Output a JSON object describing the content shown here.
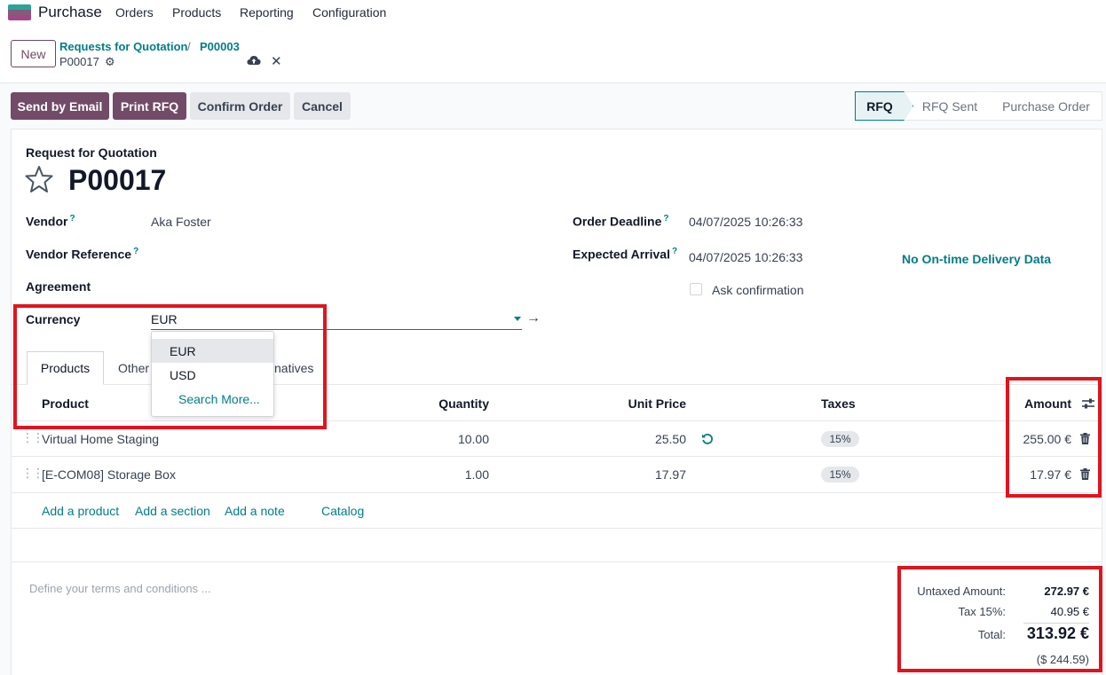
{
  "nav": {
    "app_name": "Purchase",
    "menu": [
      "Orders",
      "Products",
      "Reporting",
      "Configuration"
    ]
  },
  "control": {
    "new_label": "New",
    "breadcrumb": [
      "Requests for Quotation",
      "P00003"
    ],
    "breadcrumb_sep": "/",
    "record": "P00017"
  },
  "actions": {
    "send_email": "Send by Email",
    "print_rfq": "Print RFQ",
    "confirm": "Confirm Order",
    "cancel": "Cancel"
  },
  "statusbar": [
    "RFQ",
    "RFQ Sent",
    "Purchase Order"
  ],
  "form": {
    "doc_type": "Request for Quotation",
    "doc_name": "P00017",
    "vendor_label": "Vendor",
    "vendor_value": "Aka Foster",
    "vendor_ref_label": "Vendor Reference",
    "agreement_label": "Agreement",
    "currency_label": "Currency",
    "currency_value": "EUR",
    "order_deadline_label": "Order Deadline",
    "order_deadline_value": "04/07/2025 10:26:33",
    "expected_arrival_label": "Expected Arrival",
    "expected_arrival_value": "04/07/2025 10:26:33",
    "ask_confirmation_label": "Ask confirmation",
    "delivery_data": "No On-time Delivery Data",
    "help_mark": "?"
  },
  "currency_dropdown": [
    "EUR",
    "USD",
    "Search More..."
  ],
  "tabs": {
    "products": "Products",
    "other_partial": "Other",
    "alternatives_partial": "natives"
  },
  "table": {
    "headers": {
      "product": "Product",
      "quantity": "Quantity",
      "unit_price": "Unit Price",
      "taxes": "Taxes",
      "amount": "Amount"
    },
    "rows": [
      {
        "product": "Virtual Home Staging",
        "quantity": "10.00",
        "unit_price": "25.50",
        "tax": "15%",
        "amount": "255.00 €"
      },
      {
        "product": "[E-COM08] Storage Box",
        "quantity": "1.00",
        "unit_price": "17.97",
        "tax": "15%",
        "amount": "17.97 €"
      }
    ],
    "links": [
      "Add a product",
      "Add a section",
      "Add a note",
      "Catalog"
    ]
  },
  "notes_placeholder": "Define your terms and conditions ...",
  "totals": {
    "untaxed_label": "Untaxed Amount:",
    "untaxed_value": "272.97 €",
    "tax_label": "Tax 15%:",
    "tax_value": "40.95 €",
    "total_label": "Total:",
    "total_value": "313.92 €",
    "total_converted": "($ 244.59)"
  },
  "colors": {
    "brand": "#714b67",
    "accent": "#017e84",
    "annotation": "#e0141e"
  }
}
